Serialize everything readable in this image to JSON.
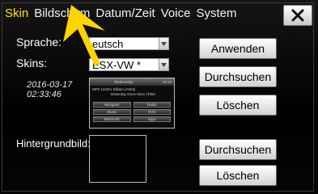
{
  "tabs": [
    {
      "label": "Skin",
      "active": true
    },
    {
      "label": "Bildschirm",
      "active": false
    },
    {
      "label": "Datum/Zeit",
      "active": false
    },
    {
      "label": "Voice",
      "active": false
    },
    {
      "label": "System",
      "active": false
    }
  ],
  "close_icon": "close-x-icon",
  "language": {
    "label": "Sprache:",
    "value": "eutsch"
  },
  "skins": {
    "label": "Skins:",
    "value": "ESX-VW *"
  },
  "skin_date": "2016-03-17",
  "skin_time": "02:33:46",
  "preview": {
    "day": "Wednesday",
    "time": "18:15",
    "track_line1": "MP3 12/321     Silliam (Artist)",
    "track_line2": "Yesterday Once More (Title)",
    "buttons": [
      "Navigator",
      "Radio",
      "Music",
      "DVD",
      "Bluetooth",
      "Apps"
    ]
  },
  "background_label": "Hintergrundbild:",
  "buttons": {
    "apply": "Anwenden",
    "browse_skin": "Durchsuchen",
    "delete_skin": "Löschen",
    "browse_bg": "Durchsuchen",
    "delete_bg": "Löschen"
  },
  "colors": {
    "active_tab": "#ffe600",
    "pointer": "#ffd400"
  }
}
